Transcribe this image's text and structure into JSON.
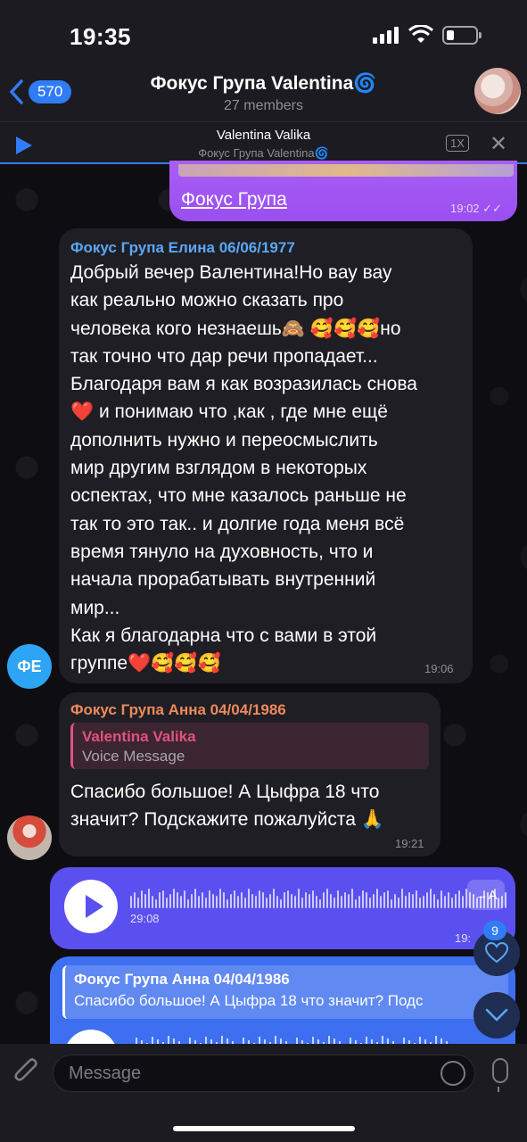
{
  "status": {
    "time": "19:35"
  },
  "header": {
    "back_count": "570",
    "title": "Фокус Група Valentina🌀",
    "subtitle": "27 members"
  },
  "player": {
    "name": "Valentina Valika",
    "chat": "Фокус Група Valentina🌀",
    "speed": "1X"
  },
  "messages": {
    "out_link": "Фокус Група",
    "out_time": "19:02",
    "msg1": {
      "sender": "Фокус Група Елина 06/06/1977",
      "sender_color": "#5aa7f5",
      "lines": [
        "Добрый вечер Валентина!Но вау вау",
        "как реально можно  сказать про",
        "человека кого незнаешь🙈 🥰🥰🥰но",
        "так точно что дар речи пропадает...",
        "Благодаря вам я как возразилась снова",
        "❤️ и понимаю что ,как , где мне  ещё",
        "дополнить нужно и переосмыслить",
        "мир другим взглядом в некоторых",
        "оспектах, что мне казалось раньше не",
        "так то это так.. и долгие года меня всё",
        "время тянуло на духовность, что и",
        "начала прорабатывать внутренний",
        "мир...",
        "Как я благодарна что с вами в этой",
        "группе❤️🥰🥰🥰"
      ],
      "time": "19:06",
      "avatar_initials": "ФЕ"
    },
    "msg2": {
      "sender": "Фокус Група Анна 04/04/1986",
      "sender_color": "#ee8a5d",
      "reply_name": "Valentina Valika",
      "reply_text": "Voice Message",
      "lines": [
        "Спасибо большое! А Цыфра 18 что",
        "значит? Подскажите пожалуйста 🙏"
      ],
      "time": "19:21"
    },
    "voice": {
      "duration": "29:08",
      "transcribe": "→A",
      "time": "19:"
    },
    "fwd": {
      "reply_name": "Фокус Група Анна 04/04/1986",
      "reply_text": "Спасибо большое! А Цыфра 18 что значит? Подс"
    }
  },
  "floating": {
    "heart_badge": "9"
  },
  "input": {
    "placeholder": "Message"
  },
  "colors": {
    "accent": "#2f7cf6",
    "outgoing": "#9a4ef1",
    "voice_bubble": "#5a50f0"
  }
}
